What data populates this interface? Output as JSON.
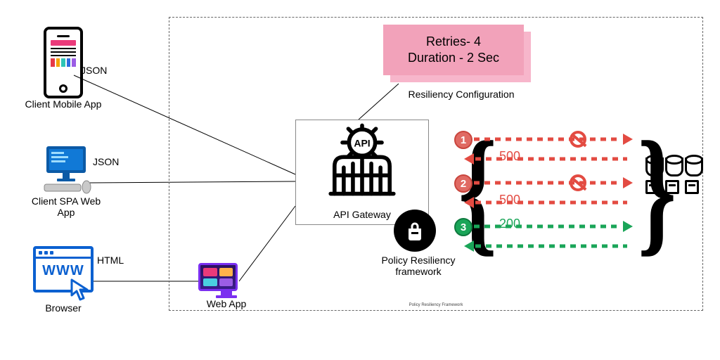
{
  "clients": {
    "mobile": {
      "label": "Client Mobile App",
      "protocol": "JSON"
    },
    "spa": {
      "label": "Client SPA Web\nApp",
      "protocol": "JSON"
    },
    "browser": {
      "label": "Browser",
      "protocol": "HTML"
    }
  },
  "webapp": {
    "label": "Web App"
  },
  "gateway": {
    "label": "API Gateway"
  },
  "policy": {
    "label": "Policy Resiliency\nframework"
  },
  "config": {
    "line1": "Retries- 4",
    "line2": "Duration - 2 Sec",
    "caption": "Resiliency Configuration"
  },
  "retries": {
    "attempts": [
      {
        "n": "1",
        "status": "500",
        "ok": false
      },
      {
        "n": "2",
        "status": "500",
        "ok": false
      },
      {
        "n": "3",
        "status": "200",
        "ok": true
      }
    ]
  },
  "colors": {
    "fail": "#e34b42",
    "ok": "#1aa558"
  },
  "footer": "Policy Resiliency Framework"
}
